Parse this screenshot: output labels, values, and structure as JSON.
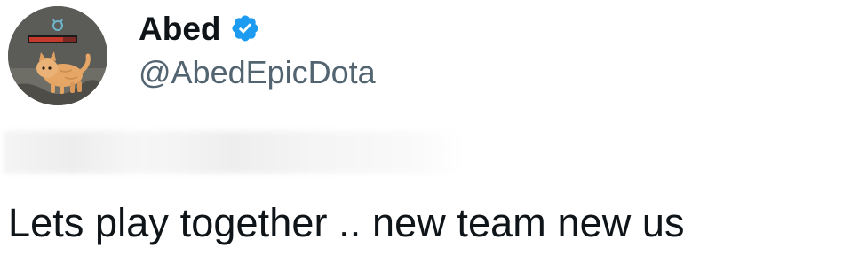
{
  "author": {
    "display_name": "Abed",
    "handle": "@AbedEpicDota",
    "verified": true,
    "verified_color": "#1d9bf0",
    "avatar_icon": "kitten-avatar-icon"
  },
  "tweet": {
    "text": "Lets play together .. new team new us"
  },
  "colors": {
    "text_primary": "#0f1419",
    "text_secondary": "#536471",
    "background": "#ffffff"
  }
}
